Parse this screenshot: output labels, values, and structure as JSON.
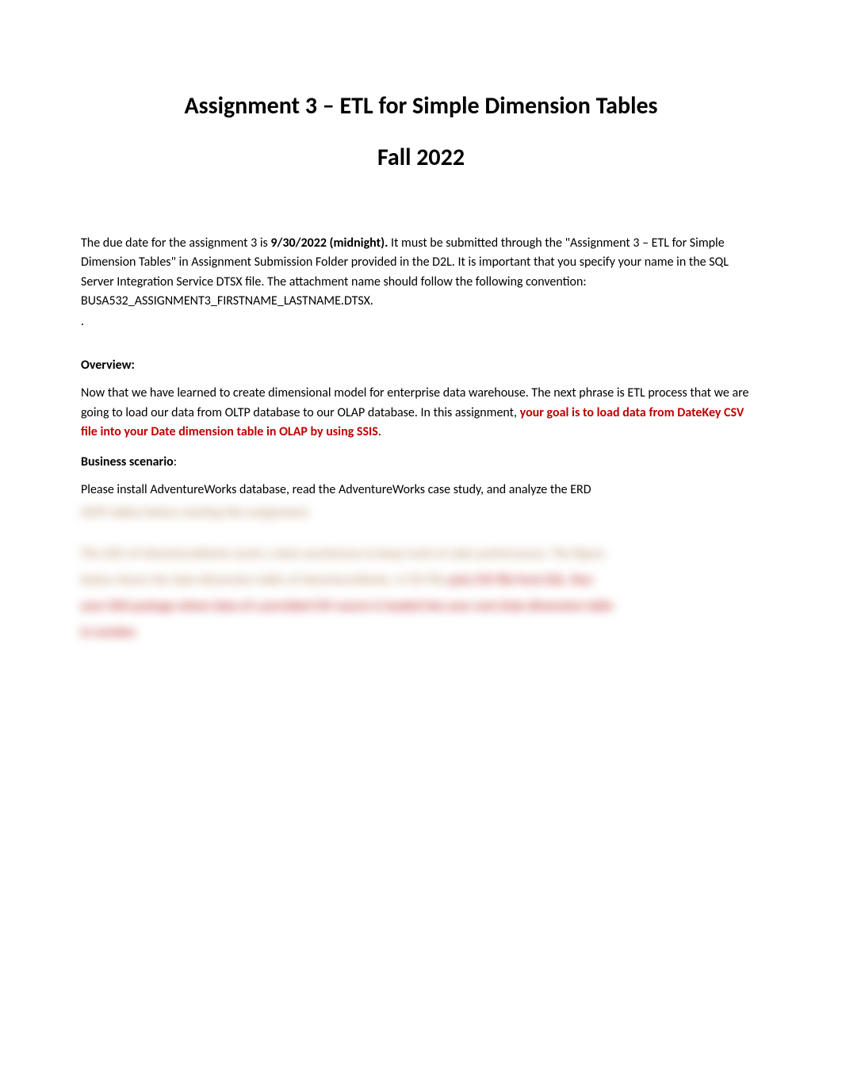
{
  "title": {
    "line1": "Assignment 3 – ETL for Simple Dimension Tables",
    "line2": "Fall 2022"
  },
  "intro": {
    "prefix": "The due date for the assignment 3 is ",
    "due_date": "9/30/2022 (midnight).",
    "rest": "  It must be submitted through the \"Assignment  3 – ETL for Simple Dimension Tables\" in Assignment Submission Folder provided in the D2L. It is important that you specify your name in the SQL Server Integration Service DTSX file. The attachment name should follow the following convention: BUSA532_ASSIGNMENT3_FIRSTNAME_LASTNAME.DTSX."
  },
  "period": ".",
  "overview": {
    "heading": "Overview:",
    "para_prefix": "Now that we have learned to create dimensional model for enterprise data warehouse. The next phrase is ETL process that we are going to load our data from OLTP database to our OLAP database. In this assignment, ",
    "para_highlight": "your goal is to load data from DateKey CSV file into your Date dimension table in OLAP by using SSIS",
    "para_suffix": "."
  },
  "business_scenario": {
    "heading_text": "Business scenario",
    "colon": ":",
    "para": "Please install AdventureWorks database, read the AdventureWorks case study, and analyze the ERD"
  },
  "blurred": {
    "line1": "OLTP tables before starting this assignment.",
    "line2a": "The CEO of AdventureWorks wants a data warehouse to keep track of sales performance. The figure",
    "line2b": "below shows the date dimension table of AdventureWorks.  A CSV file",
    "line2c": "puts CSV file from D2L. Run",
    "line3": "your SSIS package where data of a provided CSV source is loaded into your own Date dimension table",
    "line4": "in number."
  }
}
